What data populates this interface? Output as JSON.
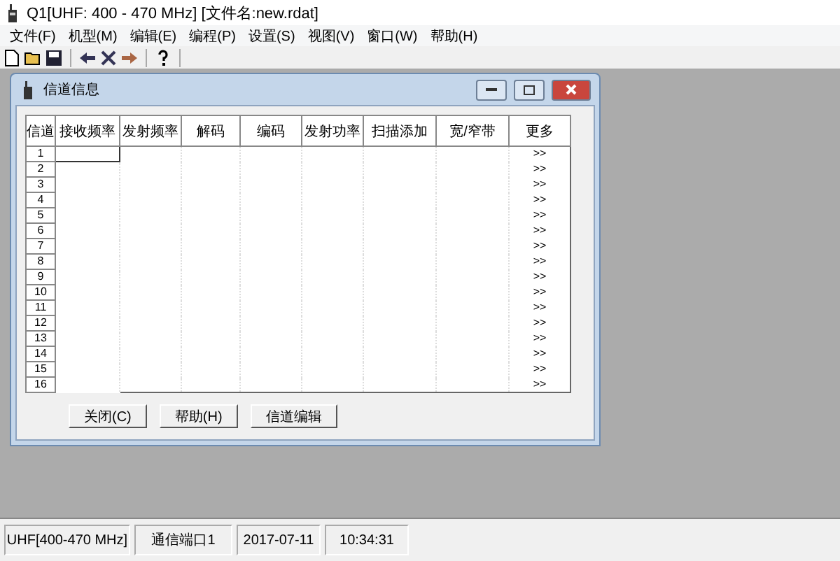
{
  "window": {
    "title": "Q1[UHF: 400 - 470 MHz] [文件名:new.rdat]"
  },
  "menu": [
    "文件(F)",
    "机型(M)",
    "编辑(E)",
    "编程(P)",
    "设置(S)",
    "视图(V)",
    "窗口(W)",
    "帮助(H)"
  ],
  "child_window": {
    "title": "信道信息",
    "table": {
      "columns": [
        "信道",
        "接收频率",
        "发射频率",
        "解码",
        "编码",
        "发射功率",
        "扫描添加",
        "宽/窄带",
        "更多"
      ],
      "rows": [
        {
          "channel": "1",
          "more": ">>",
          "selected": true
        },
        {
          "channel": "2",
          "more": ">>",
          "selected": false
        },
        {
          "channel": "3",
          "more": ">>",
          "selected": false
        },
        {
          "channel": "4",
          "more": ">>",
          "selected": false
        },
        {
          "channel": "5",
          "more": ">>",
          "selected": false
        },
        {
          "channel": "6",
          "more": ">>",
          "selected": false
        },
        {
          "channel": "7",
          "more": ">>",
          "selected": false
        },
        {
          "channel": "8",
          "more": ">>",
          "selected": false
        },
        {
          "channel": "9",
          "more": ">>",
          "selected": false
        },
        {
          "channel": "10",
          "more": ">>",
          "selected": false
        },
        {
          "channel": "11",
          "more": ">>",
          "selected": false
        },
        {
          "channel": "12",
          "more": ">>",
          "selected": false
        },
        {
          "channel": "13",
          "more": ">>",
          "selected": false
        },
        {
          "channel": "14",
          "more": ">>",
          "selected": false
        },
        {
          "channel": "15",
          "more": ">>",
          "selected": false
        },
        {
          "channel": "16",
          "more": ">>",
          "selected": false
        }
      ]
    },
    "buttons": [
      "关闭(C)",
      "帮助(H)",
      "信道编辑"
    ]
  },
  "status_bar": [
    "UHF[400-470 MHz]",
    "通信端口1",
    "2017-07-11",
    "10:34:31"
  ]
}
